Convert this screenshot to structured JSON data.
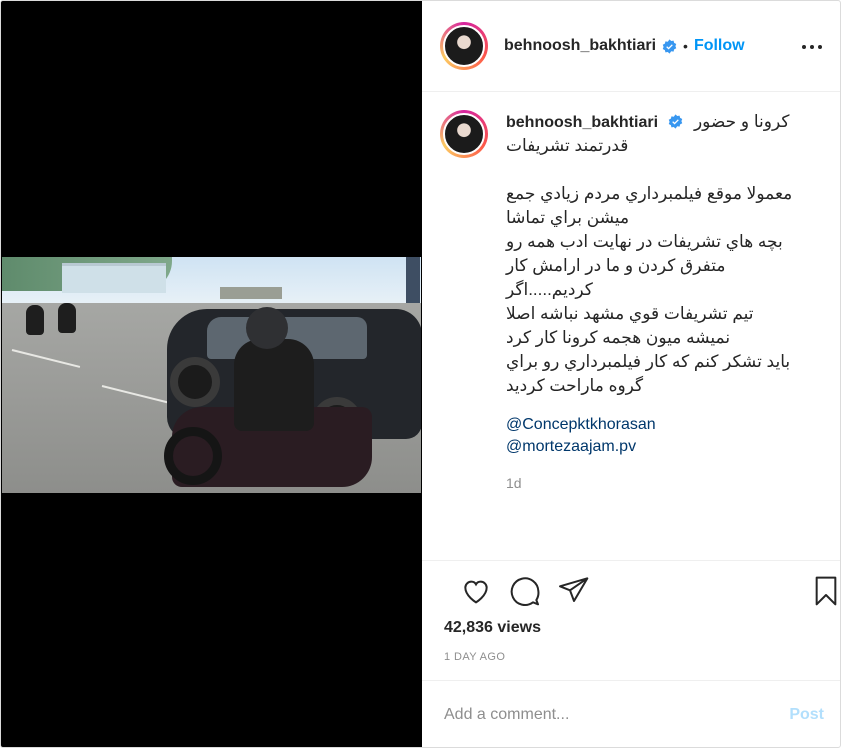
{
  "post": {
    "username": "behnoosh_bakhtiari",
    "follow_label": "Follow",
    "separator": "•",
    "caption_line1": "كرونا و حضور",
    "caption_line2": "قدرتمند تشريفات",
    "caption_para": [
      "معمولا موقع فيلمبرداري مردم زيادي جمع",
      "ميشن براي تماشا",
      "بچه هاي تشريفات در نهايت ادب همه رو",
      "متفرق كردن و ما در ارامش كار كرديم.....اگر",
      "تيم تشريفات قوي مشهد نباشه اصلا",
      "نميشه ميون هجمه كرونا كار كرد",
      "بايد تشكر كنم كه كار فيلمبرداري رو براي",
      "گروه ماراحت كرديد"
    ],
    "mentions": [
      "@Concepktkhorasan",
      "@mortezaajam.pv"
    ],
    "time_ago": "1d",
    "views": "42,836 views",
    "date": "1 DAY AGO"
  },
  "comment_box": {
    "placeholder": "Add a comment...",
    "post_label": "Post"
  },
  "icons": {
    "verified": "verified-badge-icon",
    "more": "more-options-icon",
    "like": "heart-icon",
    "comment": "comment-bubble-icon",
    "share": "paper-plane-icon",
    "save": "bookmark-icon"
  },
  "colors": {
    "accent": "#0095f6",
    "post_disabled": "#b2dffc",
    "mention": "#00376b",
    "muted": "#8e8e8e",
    "media_bg": "#000000"
  }
}
